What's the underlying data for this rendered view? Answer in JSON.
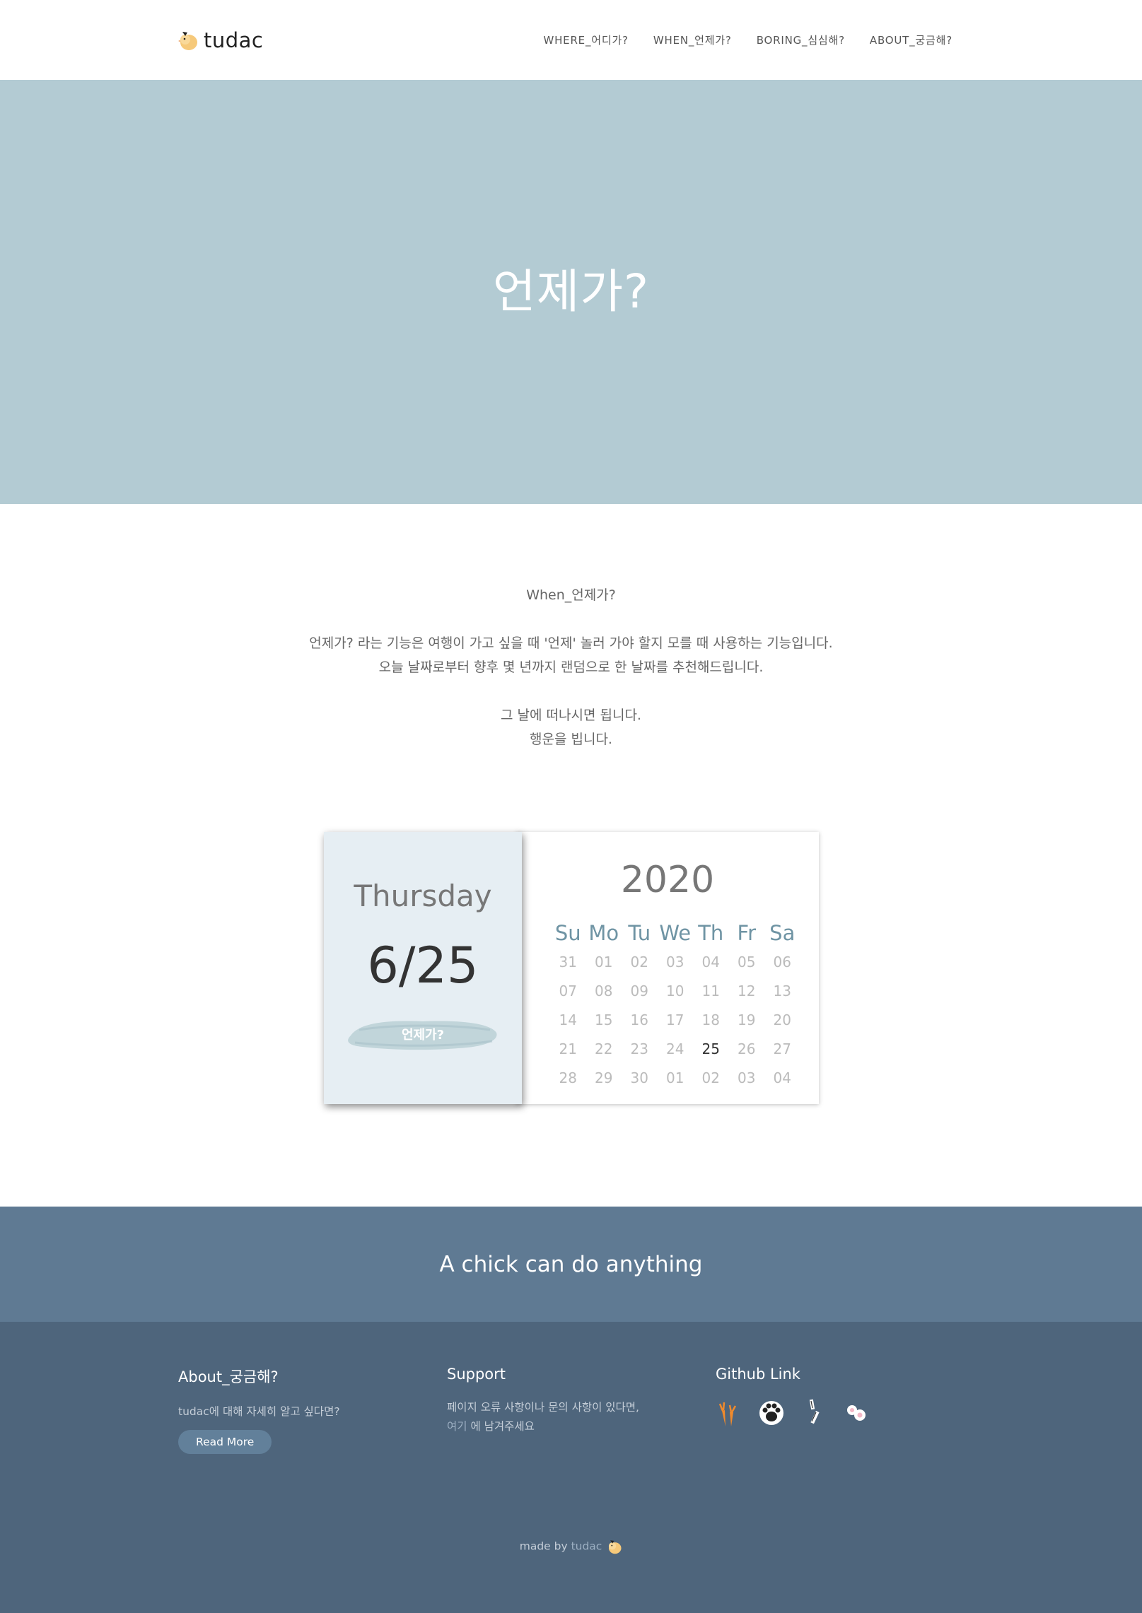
{
  "header": {
    "brand": "tudac",
    "nav": [
      "WHERE_어디가?",
      "WHEN_언제가?",
      "BORING_심심해?",
      "ABOUT_궁금해?"
    ]
  },
  "hero": {
    "title": "언제가?"
  },
  "intro": {
    "heading": "When_언제가?",
    "line1": "언제가? 라는 기능은 여행이 가고 싶을 때 '언제' 놀러 가야 할지 모를 때 사용하는 기능입니다.",
    "line2": "오늘 날짜로부터 향후 몇 년까지 랜덤으로 한 날짜를 추천해드립니다.",
    "line3": "그 날에 떠나시면 됩니다.",
    "line4": "행운을 빕니다."
  },
  "calendar": {
    "weekday": "Thursday",
    "date": "6/25",
    "button": "언제가?",
    "year": "2020",
    "day_headers": [
      "Su",
      "Mo",
      "Tu",
      "We",
      "Th",
      "Fr",
      "Sa"
    ],
    "weeks": [
      [
        "31",
        "01",
        "02",
        "03",
        "04",
        "05",
        "06"
      ],
      [
        "07",
        "08",
        "09",
        "10",
        "11",
        "12",
        "13"
      ],
      [
        "14",
        "15",
        "16",
        "17",
        "18",
        "19",
        "20"
      ],
      [
        "21",
        "22",
        "23",
        "24",
        "25",
        "26",
        "27"
      ],
      [
        "28",
        "29",
        "30",
        "01",
        "02",
        "03",
        "04"
      ]
    ],
    "selected": "25"
  },
  "tagline": "A chick can do anything",
  "footer": {
    "about": {
      "title": "About_궁금해?",
      "text": "tudac에 대해 자세히 알고 싶다면?",
      "button": "Read More"
    },
    "support": {
      "title": "Support",
      "line1": "페이지 오류 사항이나 문의 사항이 있다면,",
      "link": "여기",
      "line2": " 에 남겨주세요"
    },
    "github": {
      "title": "Github Link",
      "icons": [
        "carrot-icon",
        "paw-icon",
        "pencil-icon",
        "flower-icon"
      ]
    },
    "made_by_prefix": "made by ",
    "made_by_link": "tudac"
  },
  "colors": {
    "hero_bg": "#b3cbd3",
    "tagline_bg": "#5f7a93",
    "footer_bg": "#4e657c",
    "calendar_left_bg": "#e6eef3",
    "day_header": "#6f94a4"
  }
}
